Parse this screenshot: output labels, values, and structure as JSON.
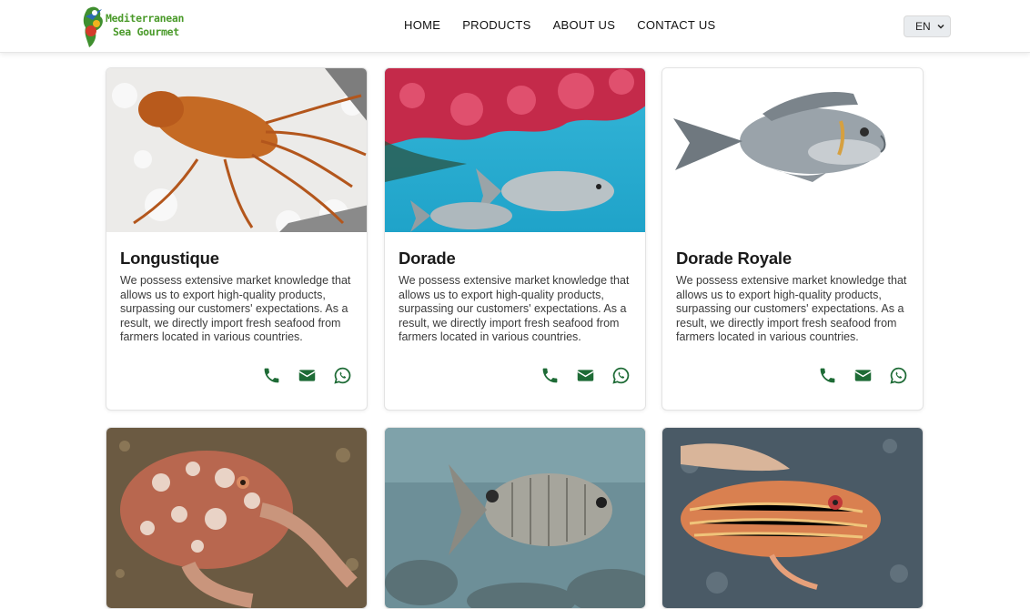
{
  "header": {
    "logo_line1": "Mediterranean",
    "logo_line2": "Sea Gourmet",
    "nav": [
      "HOME",
      "PRODUCTS",
      "ABOUT US",
      "CONTACT US"
    ],
    "language": "EN"
  },
  "colors": {
    "accent_green": "#1e6b36",
    "logo_green": "#4a9a2a"
  },
  "products": [
    {
      "name": "Longustique",
      "description": "We possess extensive market knowledge that allows us to export high-quality products, surpassing our customers' expectations. As a result, we directly import fresh seafood from farmers located in various countries.",
      "icons": [
        "phone-icon",
        "envelope-icon",
        "whatsapp-icon"
      ]
    },
    {
      "name": "Dorade",
      "description": "We possess extensive market knowledge that allows us to export high-quality products, surpassing our customers' expectations. As a result, we directly import fresh seafood from farmers located in various countries.",
      "icons": [
        "phone-icon",
        "envelope-icon",
        "whatsapp-icon"
      ]
    },
    {
      "name": "Dorade Royale",
      "description": "We possess extensive market knowledge that allows us to export high-quality products, surpassing our customers' expectations. As a result, we directly import fresh seafood from farmers located in various countries.",
      "icons": [
        "phone-icon",
        "envelope-icon",
        "whatsapp-icon"
      ]
    }
  ]
}
